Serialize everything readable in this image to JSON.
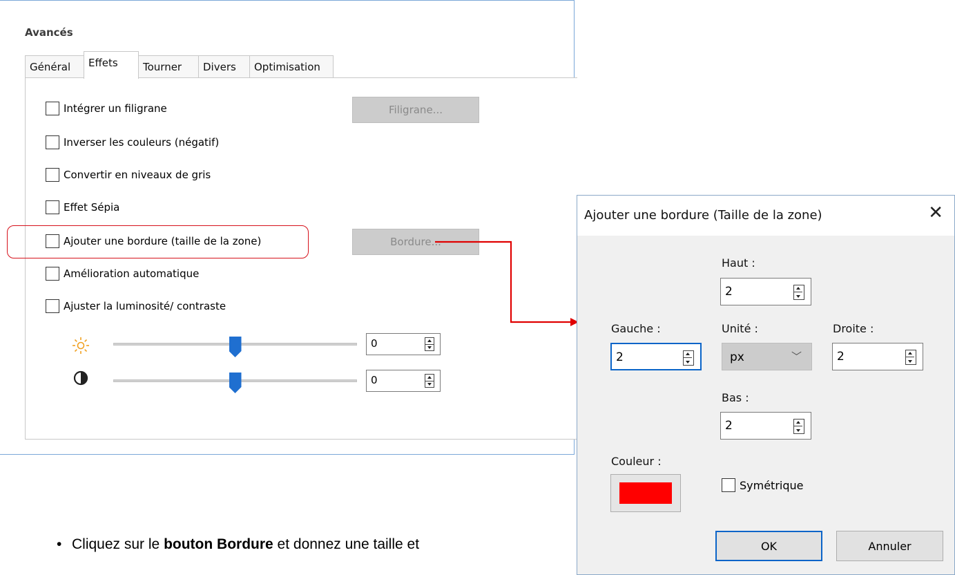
{
  "panel": {
    "title": "Avancés",
    "tabs": [
      "Général",
      "Effets",
      "Tourner",
      "Divers",
      "Optimisation"
    ],
    "active_tab": "Effets",
    "options": [
      {
        "label": "Intégrer un filigrane",
        "checked": false
      },
      {
        "label": "Inverser les couleurs (négatif)",
        "checked": false
      },
      {
        "label": "Convertir en niveaux de gris",
        "checked": false
      },
      {
        "label": "Effet Sépia",
        "checked": false
      },
      {
        "label": "Ajouter une bordure (taille de la zone)",
        "checked": false
      },
      {
        "label": "Amélioration automatique",
        "checked": false
      },
      {
        "label": "Ajuster la luminosité/ contraste",
        "checked": false
      }
    ],
    "filigrane_button": "Filigrane...",
    "bordure_button": "Bordure...",
    "brightness": {
      "value": "0",
      "slider_fraction": 0.5,
      "icon": "sun-icon"
    },
    "contrast": {
      "value": "0",
      "slider_fraction": 0.5,
      "icon": "contrast-icon"
    },
    "highlight_color": "#d6101a"
  },
  "dialog": {
    "title": "Ajouter une bordure (Taille de la zone)",
    "close_icon": "close-icon",
    "haut_label": "Haut :",
    "haut_value": "2",
    "gauche_label": "Gauche :",
    "gauche_value": "2",
    "unite_label": "Unité :",
    "unite_value": "px",
    "droite_label": "Droite :",
    "droite_value": "2",
    "bas_label": "Bas :",
    "bas_value": "2",
    "couleur_label": "Couleur :",
    "couleur_value": "#ff0000",
    "symetrique_label": "Symétrique",
    "symetrique_checked": false,
    "ok_label": "OK",
    "cancel_label": "Annuler"
  },
  "caption": {
    "prefix": "Cliquez sur le ",
    "bold": "bouton Bordure",
    "suffix": " et donnez une taille et"
  },
  "connector_color": "#e00000"
}
